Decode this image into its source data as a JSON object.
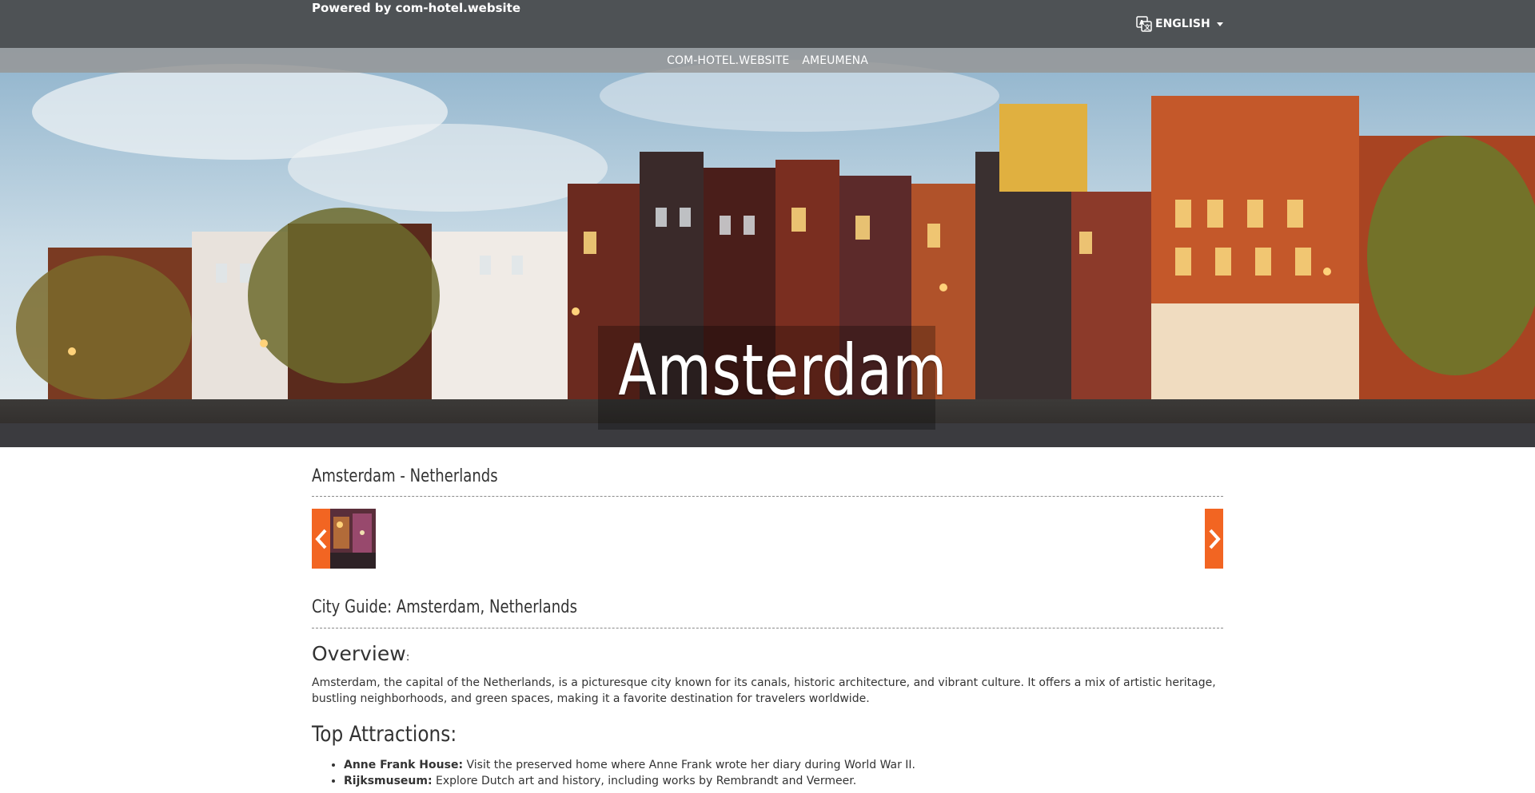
{
  "topbar": {
    "powered_by": "Powered by com-hotel.website",
    "language": "ENGLISH"
  },
  "nav": {
    "items": [
      "COM-HOTEL.WEBSITE",
      "AMEUMENA"
    ]
  },
  "hero": {
    "title": "Amsterdam"
  },
  "main": {
    "city_heading": "Amsterdam - Netherlands",
    "guide_heading": "City Guide: Amsterdam, Netherlands",
    "overview_heading": "Overview",
    "overview_colon": ":",
    "overview_text": "Amsterdam, the capital of the Netherlands, is a picturesque city known for its canals, historic architecture, and vibrant culture. It offers a mix of artistic heritage, bustling neighborhoods, and green spaces, making it a favorite destination for travelers worldwide.",
    "attractions_heading": "Top Attractions:",
    "attractions": [
      {
        "name": "Anne Frank House:",
        "desc": " Visit the preserved home where Anne Frank wrote her diary during World War II."
      },
      {
        "name": "Rijksmuseum:",
        "desc": " Explore Dutch art and history, including works by Rembrandt and Vermeer."
      }
    ]
  },
  "colors": {
    "topbar": "#4e5255",
    "accent": "#f26522"
  }
}
